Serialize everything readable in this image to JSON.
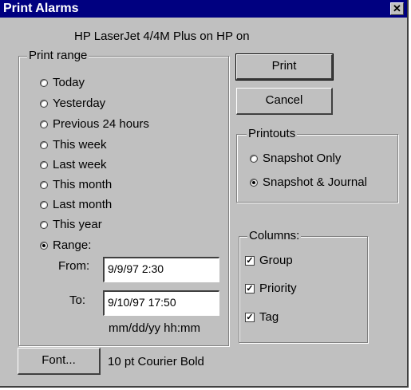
{
  "dialog": {
    "title": "Print Alarms",
    "close_label": "✕",
    "printer": "HP LaserJet 4/4M Plus on HP on"
  },
  "print_range": {
    "label": "Print range",
    "options": [
      "Today",
      "Yesterday",
      "Previous 24 hours",
      "This week",
      "Last week",
      "This month",
      "Last month",
      "This year",
      "Range:"
    ],
    "selected": "Range:",
    "from_label": "From:",
    "from_value": "9/9/97 2:30",
    "to_label": "To:",
    "to_value": "9/10/97 17:50",
    "format_hint": "mm/dd/yy hh:mm"
  },
  "buttons": {
    "print": "Print",
    "cancel": "Cancel",
    "font": "Font..."
  },
  "printouts": {
    "label": "Printouts",
    "options": [
      "Snapshot Only",
      "Snapshot & Journal"
    ],
    "selected": "Snapshot & Journal"
  },
  "columns": {
    "label": "Columns:",
    "items": [
      {
        "label": "Group",
        "checked": true
      },
      {
        "label": "Priority",
        "checked": true
      },
      {
        "label": "Tag",
        "checked": true
      }
    ]
  },
  "font_description": "10 pt Courier Bold"
}
